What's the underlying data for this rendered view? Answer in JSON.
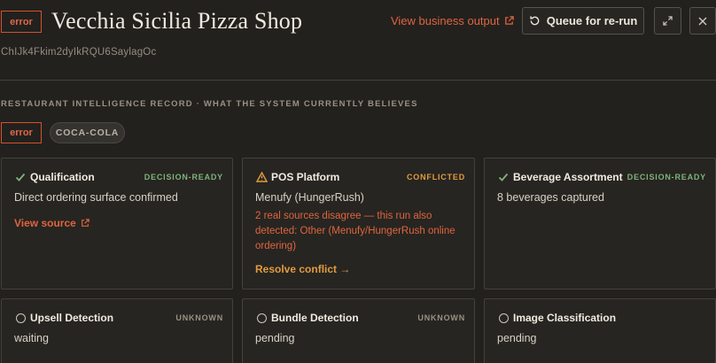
{
  "header": {
    "status_badge": "error",
    "title": "Vecchia Sicilia Pizza Shop",
    "place_id": "ChIJk4Fkim2dyIkRQU6SaylagOc",
    "view_output_label": "View business output",
    "queue_label": "Queue for re-run"
  },
  "section": {
    "label": "RESTAURANT INTELLIGENCE RECORD · WHAT THE SYSTEM CURRENTLY BELIEVES",
    "badges": {
      "status": "error",
      "brand": "COCA-COLA"
    }
  },
  "cards": {
    "qualification": {
      "title": "Qualification",
      "status": "DECISION-READY",
      "value": "Direct ordering surface confirmed",
      "link": "View source"
    },
    "pos": {
      "title": "POS Platform",
      "status": "CONFLICTED",
      "value": "Menufy (HungerRush)",
      "warning": "2 real sources disagree — this run also detected: Other (Menufy/HungerRush online ordering)",
      "action": "Resolve conflict →"
    },
    "beverage": {
      "title": "Beverage Assortment",
      "status": "DECISION-READY",
      "value": "8 beverages captured"
    },
    "upsell": {
      "title": "Upsell Detection",
      "status": "UNKNOWN",
      "value": "waiting"
    },
    "bundle": {
      "title": "Bundle Detection",
      "status": "UNKNOWN",
      "value": "pending"
    },
    "image": {
      "title": "Image Classification",
      "status": "",
      "value": "pending"
    }
  },
  "colors": {
    "accent": "#e0643e",
    "ready": "#7fb27a",
    "conflicted": "#e39a3e",
    "background": "#22211e"
  },
  "icons": [
    "external-link-icon",
    "refresh-icon",
    "expand-icon",
    "close-icon",
    "check-icon",
    "warning-icon",
    "circle-icon"
  ]
}
